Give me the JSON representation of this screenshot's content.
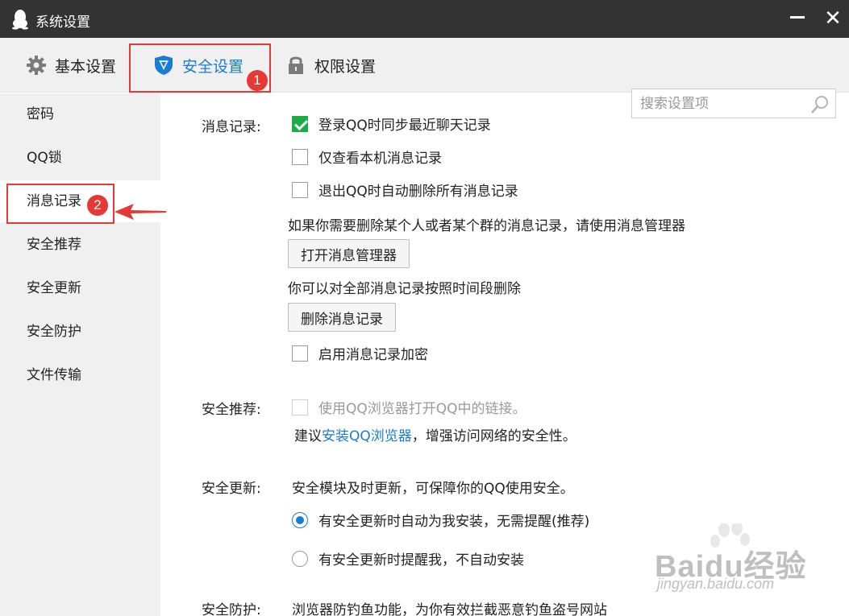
{
  "window": {
    "title": "系统设置",
    "minimize_icon": "minimize-icon",
    "close_icon": "close-icon",
    "close_glyph": "✕"
  },
  "tabs": [
    {
      "label": "基本设置",
      "icon": "gear-icon"
    },
    {
      "label": "安全设置",
      "icon": "shield-icon",
      "selected": true
    },
    {
      "label": "权限设置",
      "icon": "lock-icon"
    }
  ],
  "search": {
    "placeholder": "搜索设置项",
    "value": "",
    "icon": "search-icon"
  },
  "sidebar": {
    "items": [
      {
        "label": "密码"
      },
      {
        "label": "QQ锁"
      },
      {
        "label": "消息记录",
        "selected": true
      },
      {
        "label": "安全推荐"
      },
      {
        "label": "安全更新"
      },
      {
        "label": "安全防护"
      },
      {
        "label": "文件传输"
      }
    ]
  },
  "annotations": {
    "badge_1": "1",
    "badge_2": "2"
  },
  "message_records": {
    "label": "消息记录:",
    "sync_on_login": {
      "label": "登录QQ时同步最近聊天记录",
      "checked": true
    },
    "local_only": {
      "label": "仅查看本机消息记录",
      "checked": false
    },
    "delete_on_exit": {
      "label": "退出QQ时自动删除所有消息记录",
      "checked": false
    },
    "manager_hint": "如果你需要删除某个人或者某个群的消息记录，请使用消息管理器",
    "open_manager_button": "打开消息管理器",
    "delete_hint": "你可以对全部消息记录按照时间段删除",
    "delete_button": "删除消息记录",
    "encrypt": {
      "label": "启用消息记录加密",
      "checked": false
    }
  },
  "security_recommend": {
    "label": "安全推荐:",
    "use_browser": {
      "label": "使用QQ浏览器打开QQ中的链接。",
      "checked": false,
      "disabled": true
    },
    "suggest_prefix": "建议",
    "suggest_link": "安装QQ浏览器",
    "suggest_suffix": "，增强访问网络的安全性。"
  },
  "security_update": {
    "label": "安全更新:",
    "description": "安全模块及时更新，可保障你的QQ使用安全。",
    "auto_install": {
      "label": "有安全更新时自动为我安装，无需提醒(推荐)",
      "checked": true
    },
    "notify_only": {
      "label": "有安全更新时提醒我，不自动安装",
      "checked": false
    }
  },
  "security_protection": {
    "label": "安全防护:",
    "description": "浏览器防钓鱼功能，为你有效拦截恶意钓鱼盗号网站"
  },
  "watermark": {
    "brand": "Baidu经验",
    "url": "jingyan.baidu.com"
  },
  "colors": {
    "accent": "#1a7bd3",
    "check_green": "#1aad47",
    "annotation_red": "#e53935",
    "titlebar": "#333333",
    "panel_gray": "#f0f0f0"
  }
}
